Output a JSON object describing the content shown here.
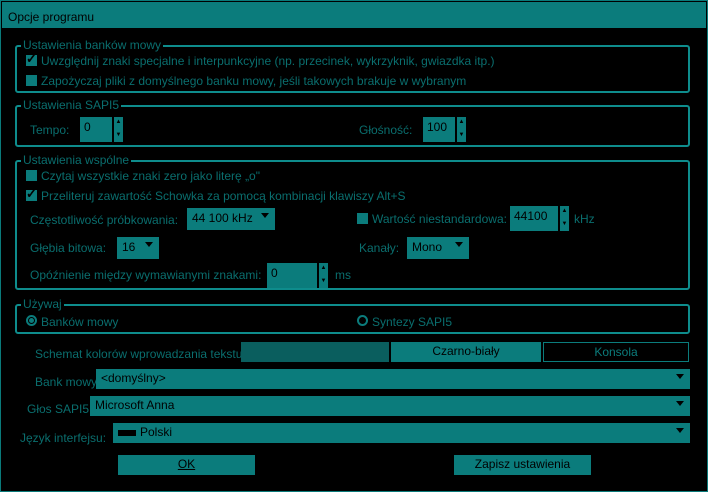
{
  "window": {
    "title": "Opcje programu"
  },
  "speech_banks": {
    "legend": "Ustawienia banków mowy",
    "opt1": "Uwzględnij znaki specjalne i interpunkcyjne (np. przecinek, wykrzyknik, gwiazdka itp.)",
    "opt1_checked": true,
    "opt2": "Zapożyczaj pliki z domyślnego banku mowy, jeśli takowych brakuje w wybranym",
    "opt2_checked": false
  },
  "sapi5": {
    "legend": "Ustawienia SAPI5",
    "tempo_label": "Tempo:",
    "tempo_value": "0",
    "volume_label": "Głośność:",
    "volume_value": "100"
  },
  "common": {
    "legend": "Ustawienia wspólne",
    "opt1": "Czytaj wszystkie znaki zero jako literę „o\"",
    "opt1_checked": false,
    "opt2": "Przeliteruj zawartość Schowka za pomocą kombinacji klawiszy Alt+S",
    "opt2_checked": true,
    "sampling_label": "Częstotliwość próbkowania:",
    "sampling_value": "44 100 kHz",
    "nonstandard_label": "Wartość niestandardowa:",
    "nonstandard_checked": false,
    "nonstandard_value": "44100",
    "nonstandard_unit": "kHz",
    "bitdepth_label": "Głębia bitowa:",
    "bitdepth_value": "16",
    "channels_label": "Kanały:",
    "channels_value": "Mono",
    "delay_label": "Opóźnienie między wymawianymi znakami:",
    "delay_value": "0",
    "delay_unit": "ms"
  },
  "use": {
    "legend": "Używaj",
    "opt1": "Banków mowy",
    "opt1_selected": true,
    "opt2": "Syntezy SAPI5",
    "opt2_selected": false
  },
  "color_scheme": {
    "label": "Schemat kolorów wprowadzania tekstu:",
    "options": [
      "",
      "Czarno-biały",
      "Konsola"
    ]
  },
  "bank": {
    "label": "Bank mowy:",
    "value": "<domyślny>"
  },
  "voice": {
    "label": "Głos SAPI5:",
    "value": "Microsoft Anna"
  },
  "language": {
    "label": "Język interfejsu:",
    "value": "Polski"
  },
  "buttons": {
    "ok": "OK",
    "save": "Zapisz ustawienia"
  },
  "colors": {
    "accent": "#0b7c7c",
    "background": "#000000",
    "text": "#0a6e6e"
  }
}
